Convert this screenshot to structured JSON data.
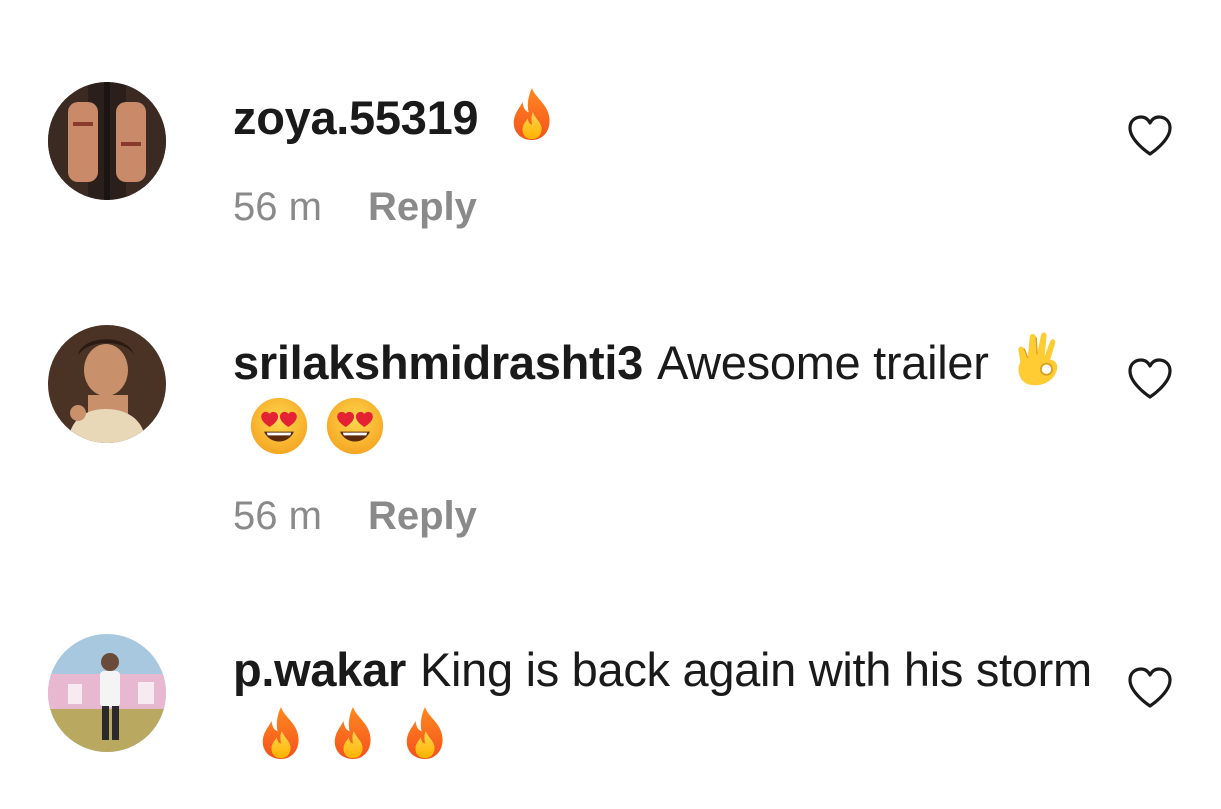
{
  "comments": [
    {
      "username": "zoya.55319",
      "text": "",
      "emojis": [
        "fire"
      ],
      "time": "56 m",
      "reply_label": "Reply",
      "avatar": "hands-photo",
      "like_icon": "heart-outline-icon"
    },
    {
      "username": "srilakshmidrashti3",
      "text": "Awesome trailer",
      "emojis": [
        "ok-hand",
        "heart-eyes",
        "heart-eyes"
      ],
      "time": "56 m",
      "reply_label": "Reply",
      "avatar": "woman-portrait-photo",
      "like_icon": "heart-outline-icon"
    },
    {
      "username": "p.wakar",
      "text": "King is back again with his storm",
      "emojis": [
        "fire",
        "fire",
        "fire"
      ],
      "time": "",
      "reply_label": "",
      "avatar": "man-outdoor-photo",
      "like_icon": "heart-outline-icon"
    }
  ],
  "colors": {
    "text": "#1a1a1a",
    "meta": "#8a8a8a",
    "background": "#ffffff"
  }
}
